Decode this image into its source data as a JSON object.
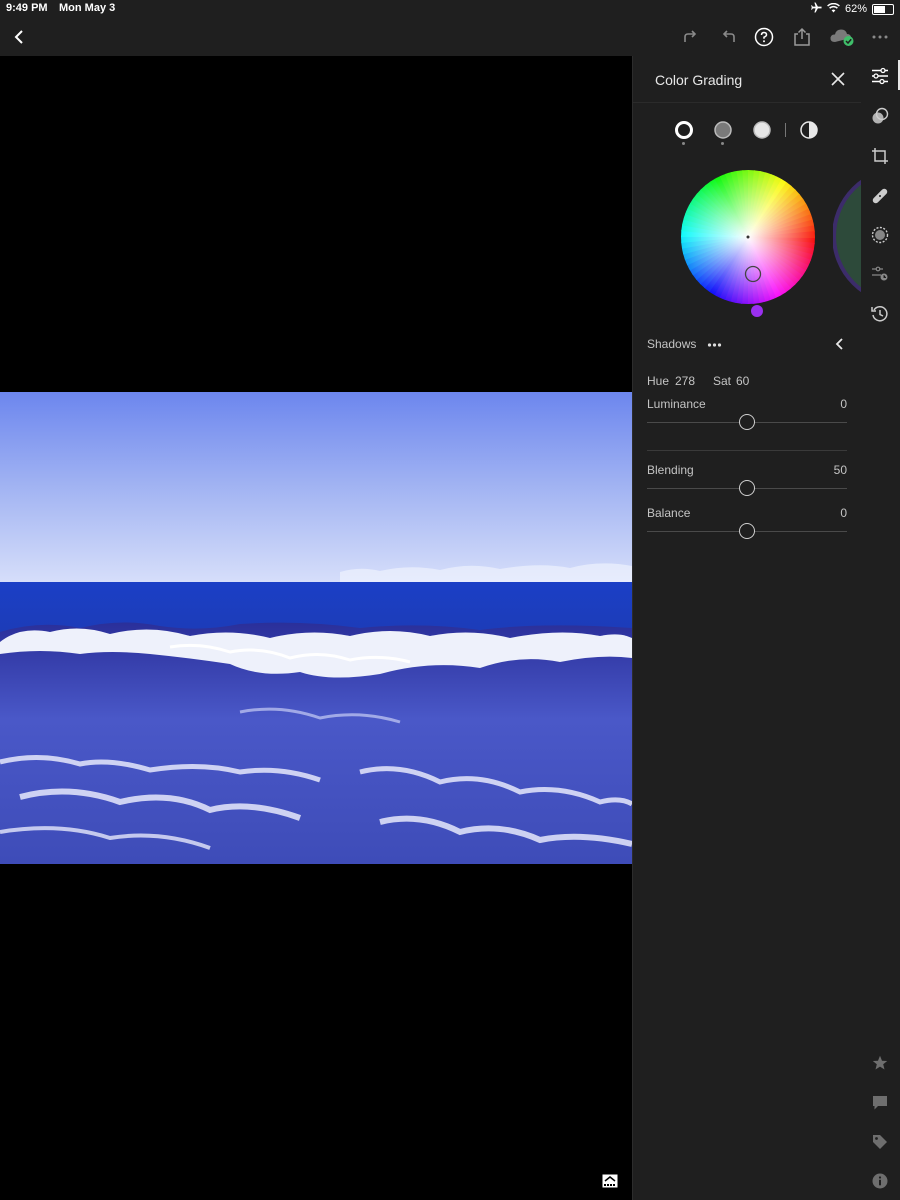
{
  "status_bar": {
    "time": "9:49 PM",
    "date": "Mon May 3",
    "battery": "62%",
    "battery_level": 0.62
  },
  "toolbar": {
    "icons": [
      "back-icon",
      "redo-icon",
      "undo-icon",
      "help-icon",
      "share-icon",
      "cloud-sync-icon",
      "more-icon"
    ]
  },
  "panel": {
    "title": "Color Grading",
    "modes": [
      "shadows-mode",
      "midtones-mode",
      "highlights-mode",
      "global-mode"
    ],
    "active_mode": "shadows-mode",
    "region_label": "Shadows",
    "hue_label": "Hue",
    "hue_value": "278",
    "sat_label": "Sat",
    "sat_value": "60",
    "luminance_label": "Luminance",
    "luminance_value": "0",
    "blending_label": "Blending",
    "blending_value": "50",
    "balance_label": "Balance",
    "balance_value": "0",
    "swatch_color": "#9b30f0"
  },
  "rail": {
    "icons": [
      "edit-sliders-icon",
      "presets-icon",
      "crop-icon",
      "healing-icon",
      "masking-icon",
      "versions-icon",
      "history-icon",
      "rating-star-icon",
      "comments-icon",
      "tags-icon",
      "info-icon"
    ],
    "active": "edit-sliders-icon"
  }
}
